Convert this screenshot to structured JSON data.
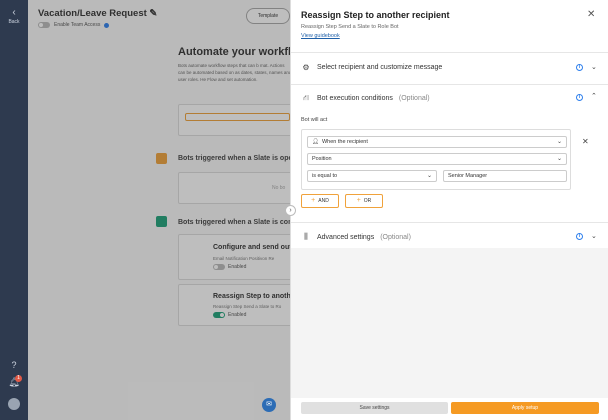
{
  "sidebar": {
    "back_label": "Back",
    "notification_count": "1"
  },
  "background": {
    "title": "Vacation/Leave Request",
    "team_access_label": "Enable Team Access",
    "template_button": "Template",
    "heading": "Automate your workflo",
    "description": "Bots automate workflow steps that can b mat. Actions can be automated based on as dates, states, names and user roles. He Flow and set automation.",
    "section_opened": "Bots triggered when a Slate is ope",
    "section_opened_placeholder": "No bo",
    "section_completed": "Bots triggered when a Slate is com",
    "cards": [
      {
        "title": "Configure and send out",
        "subtitle": "Email Notification Positivon Re",
        "status": "Enabled",
        "enabled": false
      },
      {
        "title": "Reassign Step to anothe",
        "subtitle": "Reassign Step Send a Slate to Ro",
        "status": "Enabled",
        "enabled": true
      }
    ]
  },
  "panel": {
    "title": "Reassign Step to another recipient",
    "subtitle": "Reassign Step Send a Slate to Role Bot",
    "guidebook_link": "View guidebook",
    "sections": {
      "recipient": {
        "label": "Select recipient and customize message"
      },
      "conditions": {
        "label": "Bot execution conditions",
        "optional": "(Optional)"
      },
      "advanced": {
        "label": "Advanced settings",
        "optional": "(Optional)"
      }
    },
    "bot_will_act": "Bot will act",
    "condition": {
      "when": "When the recipient",
      "field": "Position",
      "operator": "is equal to",
      "value": "Senior Manager"
    },
    "and_button": "AND",
    "or_button": "OR",
    "save_button": "Save settings",
    "apply_button": "Apply setup"
  },
  "colors": {
    "accent": "#f59a23",
    "link": "#1e5fa8",
    "info": "#2f80ed",
    "sidebar": "#2e3a4f"
  }
}
